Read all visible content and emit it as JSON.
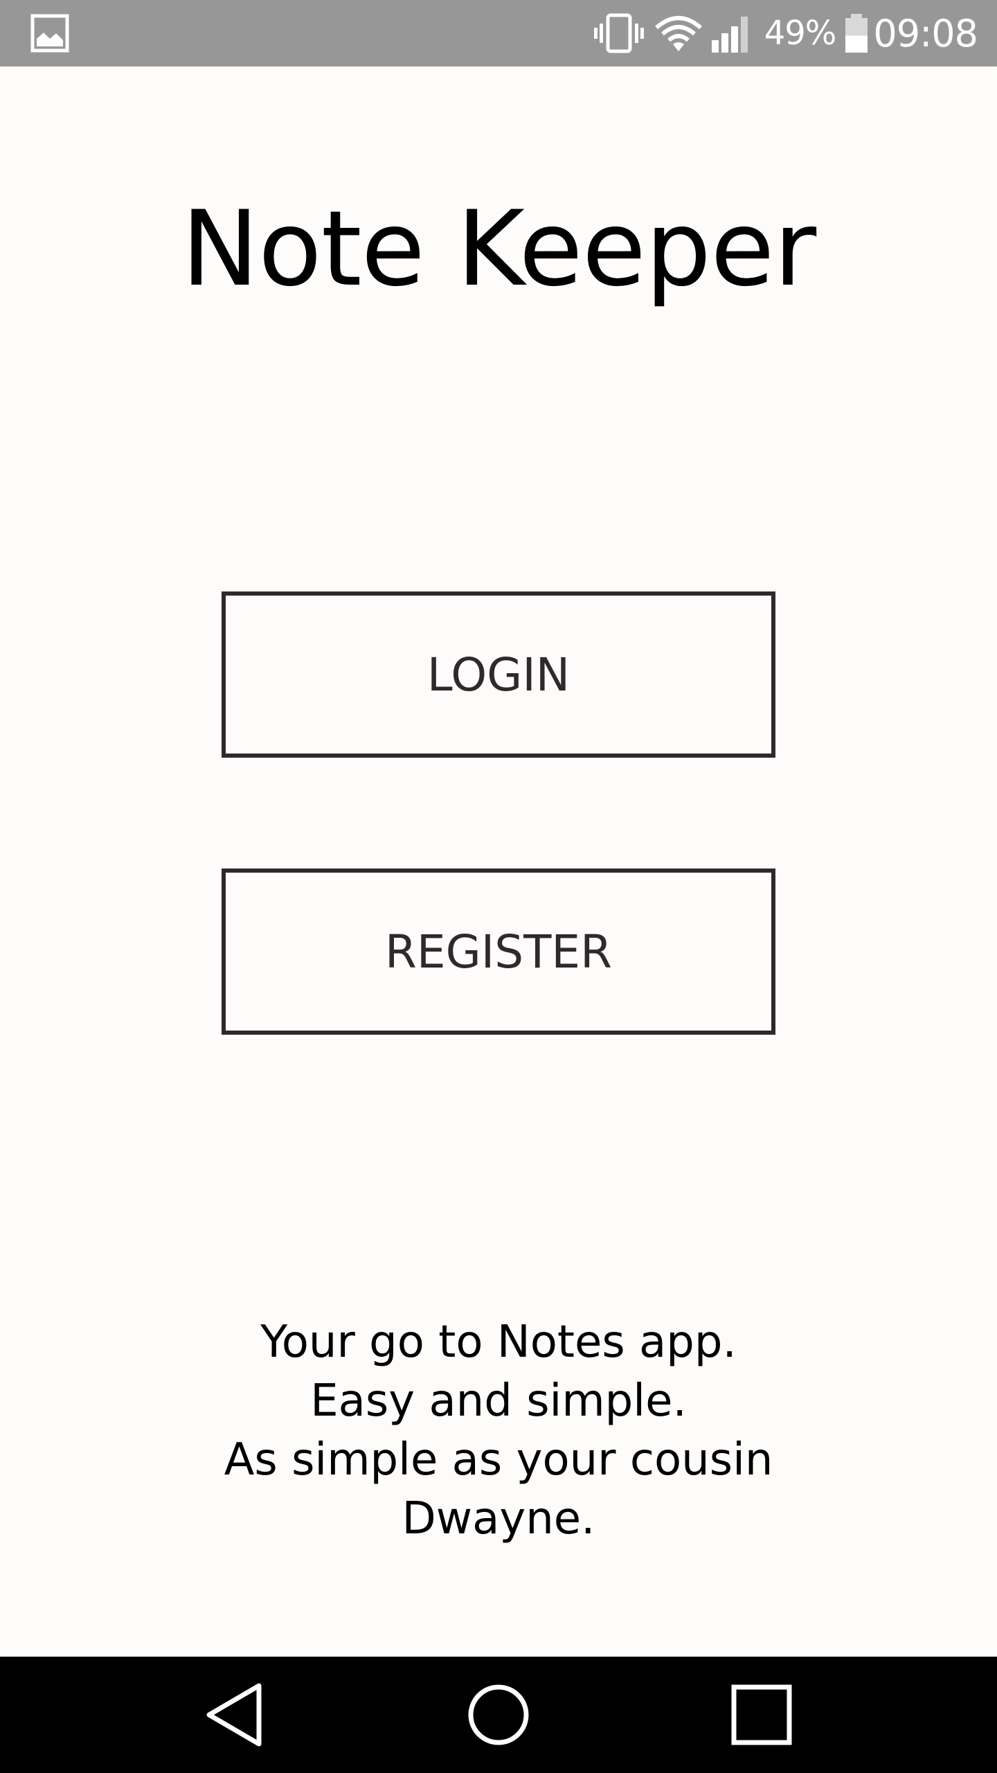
{
  "status_bar": {
    "notification_icon": "image-icon",
    "icons": [
      "vibrate-icon",
      "wifi-icon",
      "signal-icon",
      "battery-icon"
    ],
    "battery_percent": "49%",
    "battery_level": 0.49,
    "time": "09:08"
  },
  "app": {
    "title": "Note Keeper"
  },
  "buttons": {
    "login_label": "LOGIN",
    "register_label": "REGISTER"
  },
  "tagline": {
    "lines": [
      "Your go to Notes app.",
      "Easy and simple.",
      "As simple as your cousin",
      "Dwayne."
    ]
  },
  "nav_bar": {
    "icons": [
      "back-icon",
      "home-icon",
      "recents-icon"
    ]
  },
  "colors": {
    "background": "#fefcfa",
    "status_bar": "#979797",
    "button_border": "#2d2a2c",
    "nav_bar": "#000000"
  }
}
